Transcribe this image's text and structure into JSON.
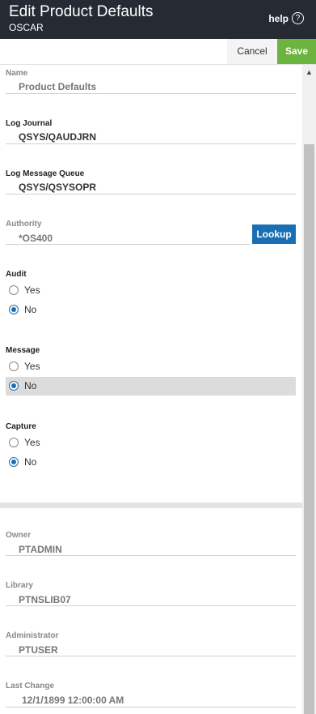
{
  "header": {
    "title": "Edit Product Defaults",
    "subtitle": "OSCAR",
    "help_label": "help",
    "help_icon": "?"
  },
  "actions": {
    "cancel": "Cancel",
    "save": "Save"
  },
  "scrollbar": {
    "up_arrow": "▲"
  },
  "fields": {
    "name": {
      "label": "Name",
      "value": "Product Defaults"
    },
    "log_journal": {
      "label": "Log Journal",
      "value": "QSYS/QAUDJRN"
    },
    "log_message_queue": {
      "label": "Log Message Queue",
      "value": "QSYS/QSYSOPR"
    },
    "authority": {
      "label": "Authority",
      "value": "*OS400",
      "lookup": "Lookup"
    }
  },
  "radios": {
    "audit": {
      "label": "Audit",
      "yes": "Yes",
      "no": "No",
      "selected": "No"
    },
    "message": {
      "label": "Message",
      "yes": "Yes",
      "no": "No",
      "selected": "No"
    },
    "capture": {
      "label": "Capture",
      "yes": "Yes",
      "no": "No",
      "selected": "No"
    }
  },
  "readonly": {
    "owner": {
      "label": "Owner",
      "value": "PTADMIN"
    },
    "library": {
      "label": "Library",
      "value": "PTNSLIB07"
    },
    "administrator": {
      "label": "Administrator",
      "value": "PTUSER"
    },
    "last_change": {
      "label": "Last Change",
      "value": "12/1/1899 12:00:00 AM"
    }
  }
}
